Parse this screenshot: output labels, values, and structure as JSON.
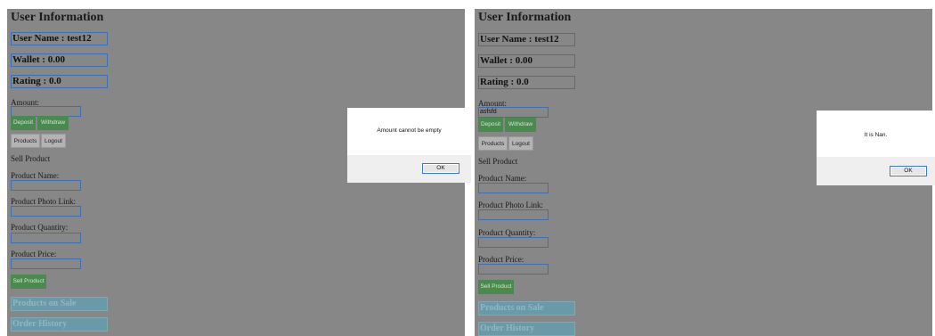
{
  "panels": [
    {
      "title": "User Information",
      "user_name": "User Name : test12",
      "wallet": "Wallet : 0.00",
      "rating": "Rating : 0.0",
      "amount_label": "Amount:",
      "amount_value": "",
      "deposit_label": "Deposit",
      "withdraw_label": "Withdraw",
      "products_label": "Products",
      "logout_label": "Logout",
      "sell_heading": "Sell Product",
      "product_name_label": "Product Name:",
      "product_photo_label": "Product Photo Link:",
      "product_quantity_label": "Product Quantity:",
      "product_price_label": "Product Price:",
      "sell_button_label": "Sell Product",
      "products_on_sale_label": "Products on Sale",
      "order_history_label": "Order History"
    },
    {
      "title": "User Information",
      "user_name": "User Name : test12",
      "wallet": "Wallet : 0.00",
      "rating": "Rating : 0.0",
      "amount_label": "Amount:",
      "amount_value": "asfsfd",
      "deposit_label": "Deposit",
      "withdraw_label": "Withdraw",
      "products_label": "Products",
      "logout_label": "Logout",
      "sell_heading": "Sell Product",
      "product_name_label": "Product Name:",
      "product_photo_label": "Product Photo Link:",
      "product_quantity_label": "Product Quantity:",
      "product_price_label": "Product Price:",
      "sell_button_label": "Sell Product",
      "products_on_sale_label": "Products on Sale",
      "order_history_label": "Order History"
    }
  ],
  "dialogs": {
    "left": {
      "message": "Amount cannot be empty",
      "ok_label": "OK"
    },
    "right": {
      "message": "It is Nan.",
      "ok_label": "OK"
    }
  },
  "colors": {
    "overlay_gray": "#878787",
    "input_border": "#3f6fb0",
    "button_green": "#4a8a4e",
    "section_bar": "#6a9aa8"
  }
}
